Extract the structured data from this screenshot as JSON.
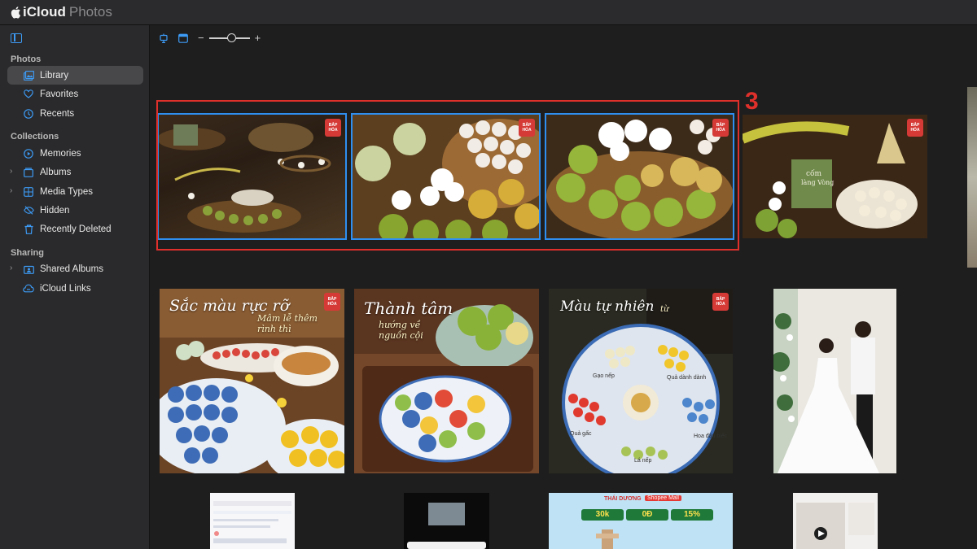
{
  "app": {
    "brand_main": "iCloud",
    "brand_sub": "Photos"
  },
  "sidebar": {
    "sections": [
      {
        "heading": "Photos",
        "items": [
          {
            "label": "Library",
            "icon": "library-icon",
            "active": true
          },
          {
            "label": "Favorites",
            "icon": "heart-icon"
          },
          {
            "label": "Recents",
            "icon": "clock-icon"
          }
        ]
      },
      {
        "heading": "Collections",
        "items": [
          {
            "label": "Memories",
            "icon": "memories-icon"
          },
          {
            "label": "Albums",
            "icon": "albums-icon",
            "expandable": true
          },
          {
            "label": "Media Types",
            "icon": "media-types-icon",
            "expandable": true
          },
          {
            "label": "Hidden",
            "icon": "eye-slash-icon"
          },
          {
            "label": "Recently Deleted",
            "icon": "trash-icon"
          }
        ]
      },
      {
        "heading": "Sharing",
        "items": [
          {
            "label": "Shared Albums",
            "icon": "shared-albums-icon",
            "expandable": true
          },
          {
            "label": "iCloud Links",
            "icon": "cloud-link-icon"
          }
        ]
      }
    ]
  },
  "toolbar": {
    "zoom_minus": "−",
    "zoom_plus": "+"
  },
  "annotation": {
    "label": "3",
    "color": "#e0302b"
  },
  "photos": {
    "row2": [
      {
        "overlay_title": "Sắc màu rực rỡ",
        "overlay_sub": "Mâm lễ thêm rình thì"
      },
      {
        "overlay_title": "Thành tâm",
        "overlay_sub": "hướng về nguồn cội"
      },
      {
        "overlay_title": "Màu tự nhiên",
        "overlay_sub": "từ",
        "labels": [
          "Gạo nếp",
          "Quả dành dành",
          "Quả gấc",
          "Hoa đậu biếc",
          "Lá nếp"
        ]
      }
    ],
    "logo": "BẮP HÓA",
    "row1_product": {
      "text_1": "cốm",
      "text_2": "làng Vòng"
    },
    "row3_shop": {
      "brand": "THÁI DƯƠNG",
      "mall": "Shopee Mall",
      "offers": [
        "30k",
        "0Đ",
        "15%"
      ]
    }
  },
  "accent": "#2f8ff0"
}
